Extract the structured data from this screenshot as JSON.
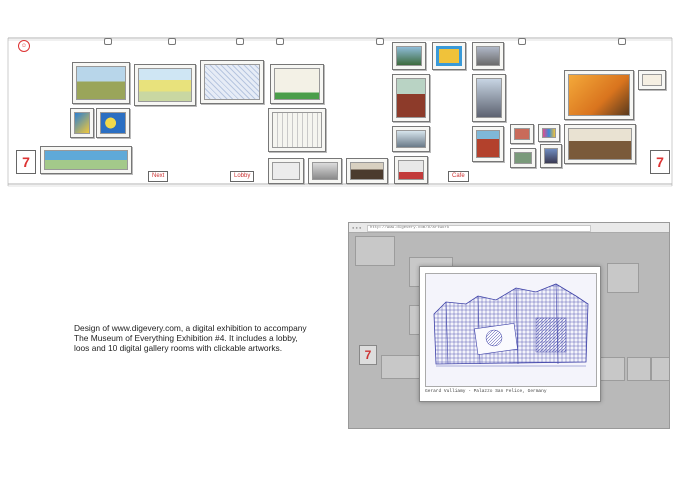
{
  "gallery": {
    "logo_glyph": "☺",
    "room_number": "7",
    "signs": [
      "Next",
      "Lobby",
      "Cafe"
    ]
  },
  "caption": {
    "lines": [
      "Design of www.digevery.com, a digital exhibition to accompany",
      "The Museum of Everything Exhibition #4. It includes a lobby,",
      "loos and 10 digital gallery rooms with clickable artworks."
    ]
  },
  "browser": {
    "url": "http://www.digevery.com/#/artwork",
    "room_number": "7",
    "artwork_caption": "Gerard Vulliamy - Palazzo San Felice, Germany"
  },
  "colors": {
    "accent": "#d33333",
    "line": "#777777",
    "modal_art": "#3b3fa6"
  }
}
